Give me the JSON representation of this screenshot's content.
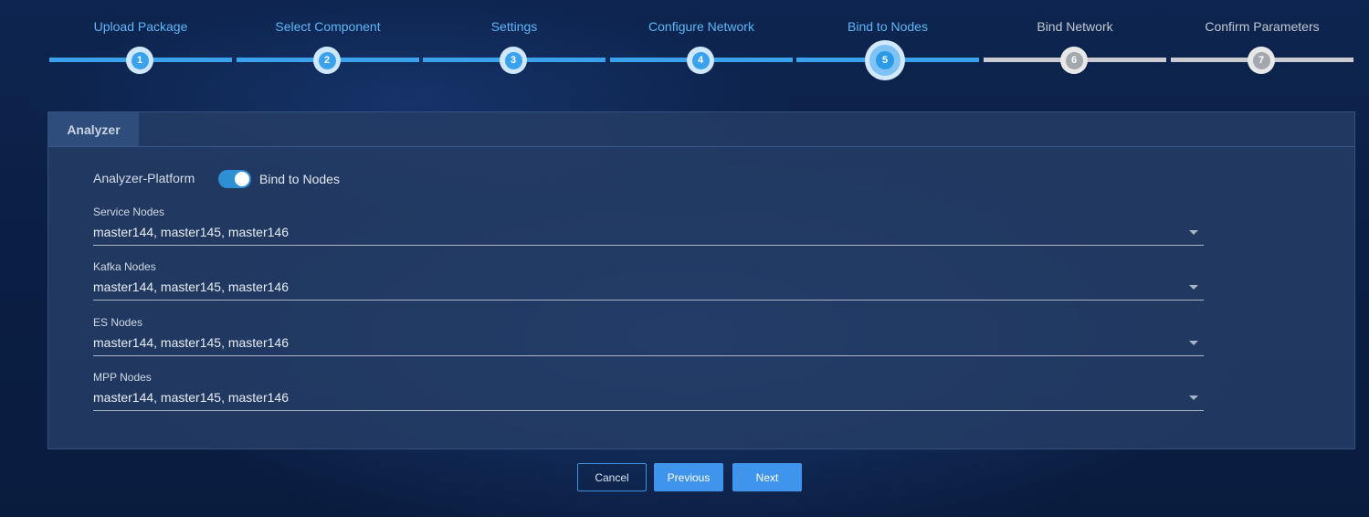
{
  "stepper": {
    "steps": [
      {
        "number": "1",
        "label": "Upload Package",
        "state": "done"
      },
      {
        "number": "2",
        "label": "Select Component",
        "state": "done"
      },
      {
        "number": "3",
        "label": "Settings",
        "state": "done"
      },
      {
        "number": "4",
        "label": "Configure Network",
        "state": "done"
      },
      {
        "number": "5",
        "label": "Bind to Nodes",
        "state": "active"
      },
      {
        "number": "6",
        "label": "Bind Network",
        "state": "pending"
      },
      {
        "number": "7",
        "label": "Confirm Parameters",
        "state": "pending"
      }
    ]
  },
  "panel": {
    "tab_label": "Analyzer",
    "platform_label": "Analyzer-Platform",
    "bind_toggle": {
      "label": "Bind to Nodes",
      "on": true
    },
    "fields": [
      {
        "label": "Service Nodes",
        "value": "master144, master145, master146"
      },
      {
        "label": "Kafka Nodes",
        "value": "master144, master145, master146"
      },
      {
        "label": "ES Nodes",
        "value": "master144, master145, master146"
      },
      {
        "label": "MPP Nodes",
        "value": "master144, master145, master146"
      }
    ]
  },
  "footer": {
    "cancel_label": "Cancel",
    "previous_label": "Previous",
    "next_label": "Next"
  },
  "colors": {
    "accent": "#3aa1ec",
    "pending": "#c9cbd0",
    "button": "#3f95ec"
  }
}
